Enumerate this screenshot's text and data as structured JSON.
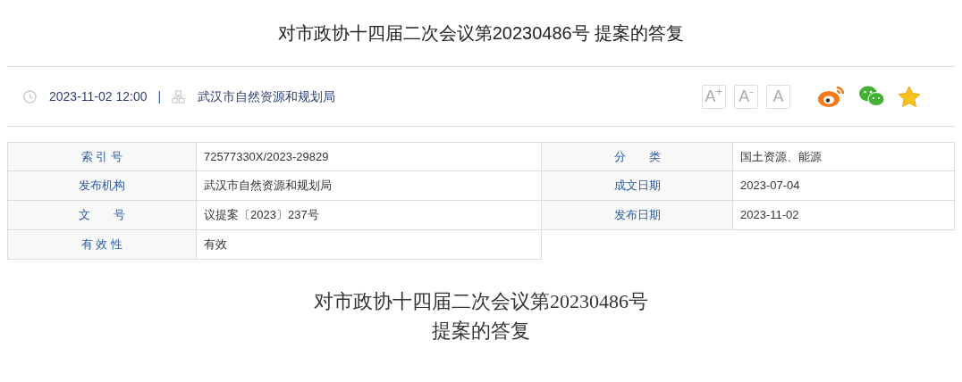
{
  "header": {
    "title": "对市政协十四届二次会议第20230486号 提案的答复"
  },
  "meta": {
    "datetime": "2023-11-02 12:00",
    "separator": "|",
    "publisher": "武汉市自然资源和规划局",
    "font_buttons": [
      "A$^{+}$",
      "A$^{-}$",
      "A"
    ]
  },
  "info_table": [
    {
      "label": "索 引 号",
      "value": "72577330X/2023-29829"
    },
    {
      "label": "分　　类",
      "value": "国土资源、能源"
    },
    {
      "label": "发布机构",
      "value": "武汉市自然资源和规划局"
    },
    {
      "label": "成文日期",
      "value": "2023-07-04"
    },
    {
      "label": "文　　号",
      "value": "议提案〔2023〕237号"
    },
    {
      "label": "发布日期",
      "value": "2023-11-02"
    },
    {
      "label": "有 效 性",
      "value": "有效"
    }
  ],
  "body": {
    "title_lines": [
      "对市政协十四届二次会议第20230486号",
      "提案的答复"
    ]
  }
}
